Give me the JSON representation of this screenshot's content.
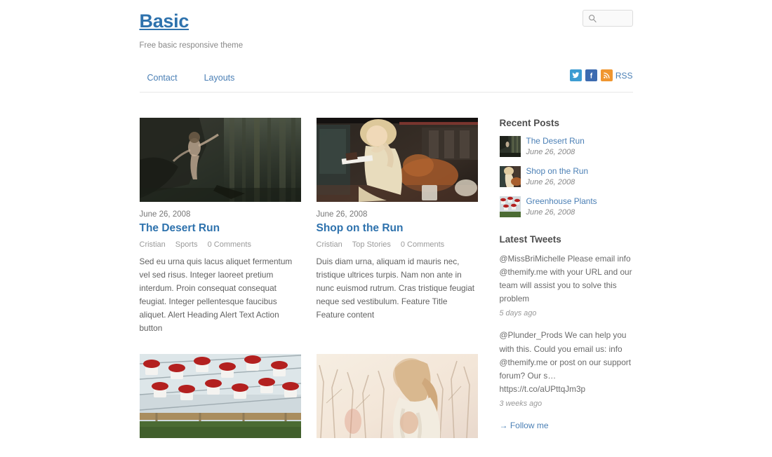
{
  "site": {
    "title": "Basic",
    "tagline": "Free basic responsive theme"
  },
  "search": {
    "value": "",
    "placeholder": "",
    "icon": "search-icon"
  },
  "nav": {
    "items": [
      {
        "label": "Contact"
      },
      {
        "label": "Layouts"
      }
    ]
  },
  "social": {
    "twitter_glyph": "t",
    "facebook_glyph": "f",
    "rss_label": "RSS"
  },
  "posts": [
    {
      "date": "June 26, 2008",
      "title": "The Desert Run",
      "author": "Cristian",
      "category": "Sports",
      "comments": "0 Comments",
      "excerpt": "Sed eu urna quis lacus aliquet fermentum vel sed risus. Integer laoreet pretium interdum. Proin consequat consequat feugiat. Integer pellentesque faucibus aliquet. Alert Heading Alert Text Action button",
      "image": "woman-in-dark-forest"
    },
    {
      "date": "June 26, 2008",
      "title": "Shop on the Run",
      "author": "Cristian",
      "category": "Top Stories",
      "comments": "0 Comments",
      "excerpt": "Duis diam urna, aliquam id mauris nec, tristique ultrices turpis. Nam non ante in nunc euismod rutrum. Cras tristique feugiat neque sed vestibulum. Feature Title Feature content",
      "image": "blonde-woman-eating-cake"
    },
    {
      "image": "greenhouse-red-flowers"
    },
    {
      "image": "blonde-woman-winter-field"
    }
  ],
  "sidebar": {
    "recent_posts": {
      "title": "Recent Posts",
      "items": [
        {
          "title": "The Desert Run",
          "date": "June 26, 2008",
          "image": "woman-in-dark-forest"
        },
        {
          "title": "Shop on the Run",
          "date": "June 26, 2008",
          "image": "blonde-woman-eating-cake"
        },
        {
          "title": "Greenhouse Plants",
          "date": "June 26, 2008",
          "image": "greenhouse-red-flowers"
        }
      ]
    },
    "latest_tweets": {
      "title": "Latest Tweets",
      "items": [
        {
          "text": "@MissBriMichelle Please email info @themify.me with your URL and our team will assist you to solve this problem",
          "time": "5 days ago"
        },
        {
          "text": "@Plunder_Prods We can help you with this. Could you email us: info @themify.me or post on our support forum? Our s… https://t.co/aUPttqJm3p",
          "time": "3 weeks ago"
        }
      ],
      "follow_label": "→ Follow me"
    }
  },
  "colors": {
    "link_blue": "#4a7fb5",
    "title_blue": "#2e72ad",
    "twitter": "#3d9cd2",
    "facebook": "#3d6bb0",
    "rss_orange": "#f0962f",
    "body_text": "#616161"
  }
}
